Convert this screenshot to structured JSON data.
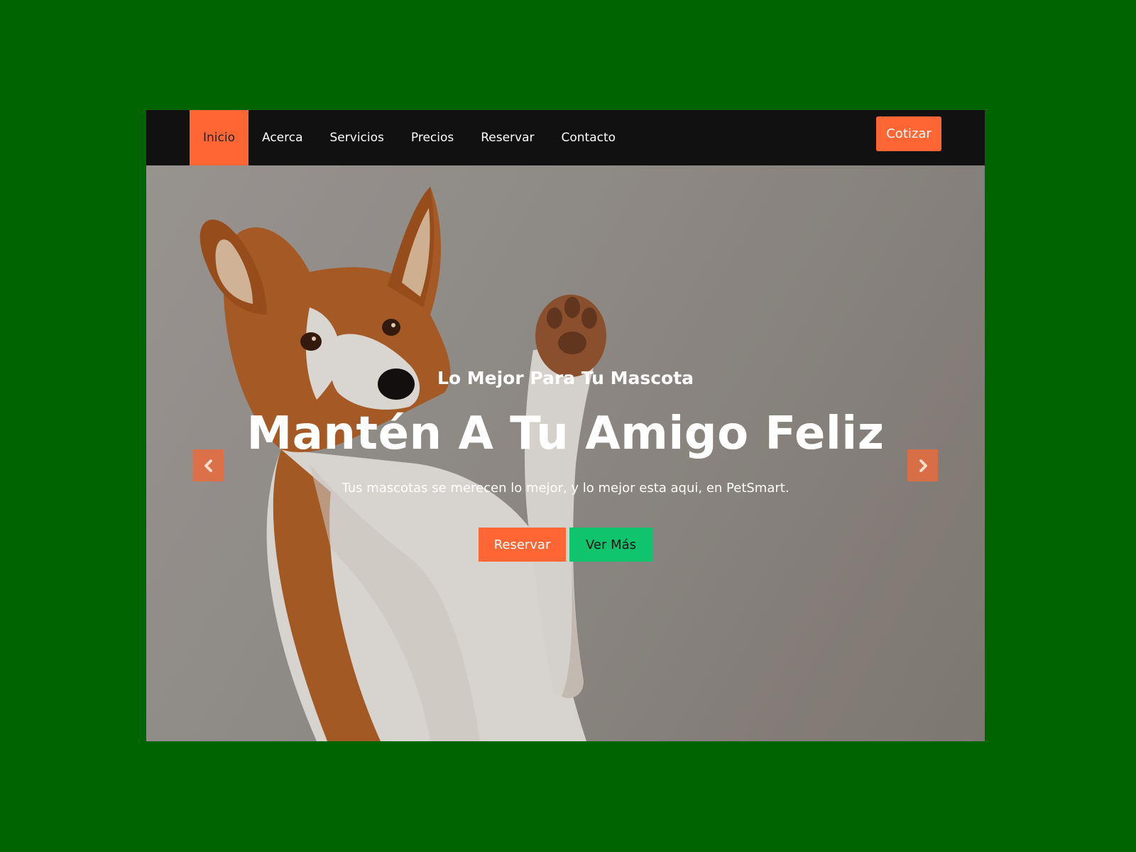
{
  "nav": {
    "items": [
      {
        "label": "Inicio",
        "active": true
      },
      {
        "label": "Acerca",
        "active": false
      },
      {
        "label": "Servicios",
        "active": false
      },
      {
        "label": "Precios",
        "active": false
      },
      {
        "label": "Reservar",
        "active": false
      },
      {
        "label": "Contacto",
        "active": false
      }
    ],
    "cta_label": "Cotizar"
  },
  "hero": {
    "eyebrow": "Lo Mejor Para Tu Mascota",
    "headline": "Mantén A Tu Amigo Feliz",
    "tagline": "Tus mascotas se merecen lo mejor, y lo mejor esta aqui, en PetSmart.",
    "primary_button": "Reservar",
    "secondary_button": "Ver Más",
    "prev_icon": "chevron-left-icon",
    "next_icon": "chevron-right-icon"
  },
  "colors": {
    "page_background": "#006400",
    "navbar": "#111111",
    "accent": "#ff6633",
    "secondary_button": "#10c46e"
  }
}
